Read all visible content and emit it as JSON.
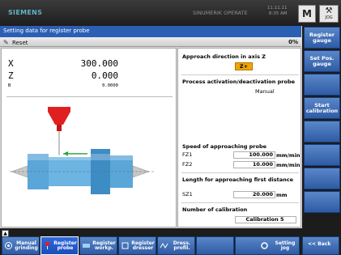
{
  "header": {
    "logo": "SIEMENS",
    "brand": "SINUMERIK OPERATE",
    "date": "11.11.11",
    "time": "8:35 AM",
    "m_button": "M",
    "jog_label": "JOG"
  },
  "title": "Setting data for register probe",
  "subheader": {
    "reset_label": "Reset",
    "percent": "0%"
  },
  "axes": [
    {
      "name": "X",
      "value": "300.000"
    },
    {
      "name": "Z",
      "value": "0.000"
    },
    {
      "name": "B",
      "value": "0.0000"
    }
  ],
  "settings": {
    "approach_dir_label": "Approach direction in axis Z",
    "approach_dir_value": "Z+",
    "activation_label": "Process activation/deactivation probe",
    "activation_value": "Manual",
    "speed_label": "Speed of approaching probe",
    "fz1_label": "FZ1",
    "fz1_value": "100.000",
    "fz1_unit": "mm/min",
    "fz2_label": "FZ2",
    "fz2_value": "10.000",
    "fz2_unit": "mm/min",
    "length_label": "Length for approaching first distance",
    "sz1_label": "SZ1",
    "sz1_value": "20.000",
    "sz1_unit": "mm",
    "calib_count_label": "Number of calibration",
    "calib_count_value": "Calibration 5"
  },
  "vertical_softkeys": [
    {
      "label": "Register gauge"
    },
    {
      "label": "Set Pos. gauge"
    },
    {
      "label": ""
    },
    {
      "label": "Start calibration"
    },
    {
      "label": ""
    },
    {
      "label": ""
    },
    {
      "label": ""
    },
    {
      "label": ""
    }
  ],
  "bottom_softkeys": [
    {
      "label": "Manual grinding",
      "icon": "grinding-wheel-icon"
    },
    {
      "label": "Register probe",
      "icon": "probe-icon"
    },
    {
      "label": "Register workp.",
      "icon": "workpiece-icon"
    },
    {
      "label": "Register dresser",
      "icon": "dresser-icon"
    },
    {
      "label": "Dress. profil.",
      "icon": "dress-profile-icon"
    },
    {
      "label": "",
      "icon": ""
    },
    {
      "label": "Setting jog",
      "icon": "setting-icon"
    },
    {
      "label": "<< Back",
      "icon": ""
    }
  ],
  "colors": {
    "title_blue": "#2b5fb4",
    "softkey_blue": "#3f6fb8",
    "highlight_orange": "#f0a500",
    "probe_red": "#e02020",
    "workpiece_blue": "#5aa6d8",
    "arrow_green": "#1a9a2a"
  }
}
